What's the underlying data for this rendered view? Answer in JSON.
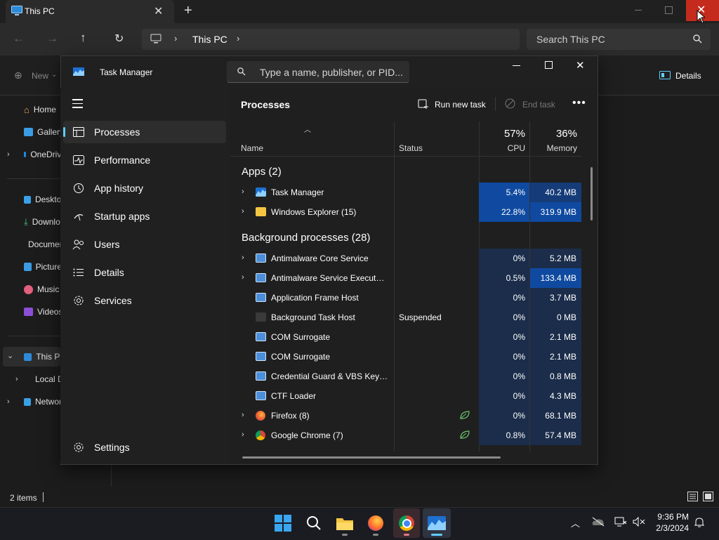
{
  "explorer": {
    "tab_title": "This PC",
    "address_text": "This PC",
    "search_placeholder": "Search This PC",
    "new_label": "New",
    "details_label": "Details",
    "nav": [
      {
        "label": "Home"
      },
      {
        "label": "Gallery"
      },
      {
        "label": "OneDrive"
      },
      {
        "label": "Desktop"
      },
      {
        "label": "Downloads"
      },
      {
        "label": "Documents"
      },
      {
        "label": "Pictures"
      },
      {
        "label": "Music"
      },
      {
        "label": "Videos"
      },
      {
        "label": "This PC"
      },
      {
        "label": "Local Disk"
      },
      {
        "label": "Network"
      }
    ],
    "status_items": "2 items"
  },
  "task_manager": {
    "title": "Task Manager",
    "search_placeholder": "Type a name, publisher, or PID...",
    "sidebar": [
      {
        "label": "Processes",
        "icon": "processes-icon"
      },
      {
        "label": "Performance",
        "icon": "performance-icon"
      },
      {
        "label": "App history",
        "icon": "app-history-icon"
      },
      {
        "label": "Startup apps",
        "icon": "startup-icon"
      },
      {
        "label": "Users",
        "icon": "users-icon"
      },
      {
        "label": "Details",
        "icon": "details-icon"
      },
      {
        "label": "Services",
        "icon": "services-icon"
      }
    ],
    "settings_label": "Settings",
    "page_title": "Processes",
    "run_new_task": "Run new task",
    "end_task": "End task",
    "columns": {
      "name": "Name",
      "status": "Status",
      "cpu_pct": "57%",
      "cpu": "CPU",
      "mem_pct": "36%",
      "memory": "Memory"
    },
    "apps_header": "Apps (2)",
    "apps": [
      {
        "name": "Task Manager",
        "status": "",
        "cpu": "5.4%",
        "mem": "40.2 MB"
      },
      {
        "name": "Windows Explorer (15)",
        "status": "",
        "cpu": "22.8%",
        "mem": "319.9 MB"
      }
    ],
    "bg_header": "Background processes (28)",
    "background": [
      {
        "name": "Antimalware Core Service",
        "status": "",
        "cpu": "0%",
        "mem": "5.2 MB"
      },
      {
        "name": "Antimalware Service Executable",
        "status": "",
        "cpu": "0.5%",
        "mem": "133.4 MB"
      },
      {
        "name": "Application Frame Host",
        "status": "",
        "cpu": "0%",
        "mem": "3.7 MB"
      },
      {
        "name": "Background Task Host",
        "status": "Suspended",
        "cpu": "0%",
        "mem": "0 MB"
      },
      {
        "name": "COM Surrogate",
        "status": "",
        "cpu": "0%",
        "mem": "2.1 MB"
      },
      {
        "name": "COM Surrogate",
        "status": "",
        "cpu": "0%",
        "mem": "2.1 MB"
      },
      {
        "name": "Credential Guard & VBS Key Is...",
        "status": "",
        "cpu": "0%",
        "mem": "0.8 MB"
      },
      {
        "name": "CTF Loader",
        "status": "",
        "cpu": "0%",
        "mem": "4.3 MB"
      },
      {
        "name": "Firefox (8)",
        "status": "",
        "cpu": "0%",
        "mem": "68.1 MB"
      },
      {
        "name": "Google Chrome (7)",
        "status": "",
        "cpu": "0.8%",
        "mem": "57.4 MB"
      }
    ]
  },
  "taskbar": {
    "time": "9:36 PM",
    "date": "2/3/2024"
  },
  "colors": {
    "accent": "#60cdff",
    "heat_low": "#1b2d4a",
    "heat_mid": "#153c78",
    "heat_high": "#0f4aa0",
    "close_red": "#c42b1c"
  }
}
